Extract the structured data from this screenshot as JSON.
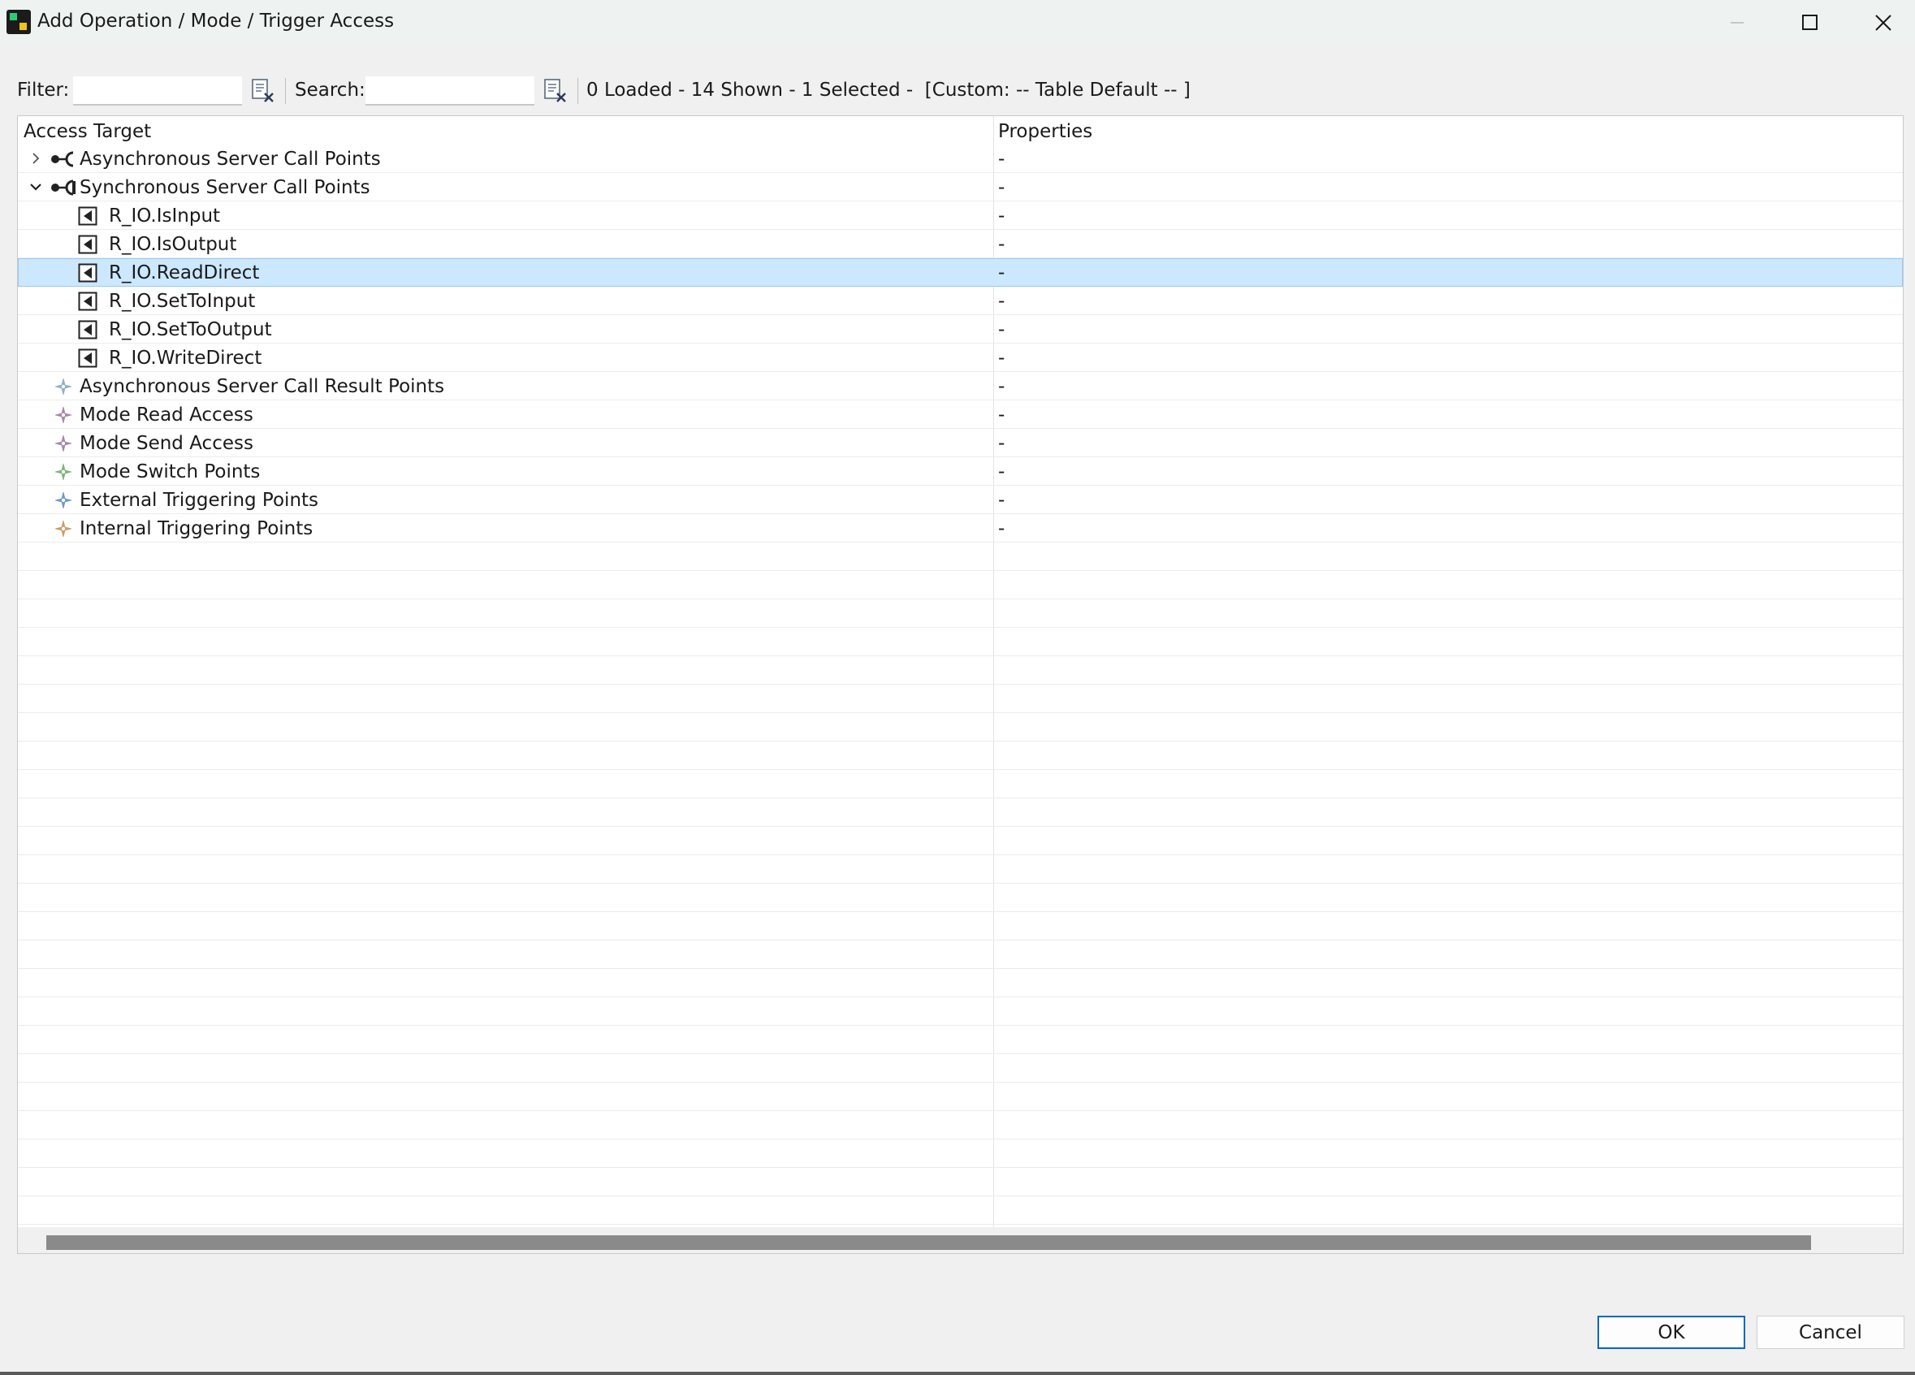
{
  "window": {
    "title": "Add Operation / Mode / Trigger Access"
  },
  "toolbar": {
    "filter_label": "Filter:",
    "filter_value": "",
    "search_label": "Search:",
    "search_value": "",
    "status": "0 Loaded - 14 Shown - 1 Selected -  [Custom: -- Table Default -- ]"
  },
  "table": {
    "columns": [
      "Access Target",
      "Properties"
    ],
    "rows": [
      {
        "label": "Asynchronous Server Call Points",
        "prop": "-",
        "level": 0,
        "toggle": "collapsed",
        "icon": "async-server-call-icon"
      },
      {
        "label": "Synchronous Server Call Points",
        "prop": "-",
        "level": 0,
        "toggle": "expanded",
        "icon": "sync-server-call-icon"
      },
      {
        "label": "R_IO.IsInput",
        "prop": "-",
        "level": 1,
        "icon": "operation-icon"
      },
      {
        "label": "R_IO.IsOutput",
        "prop": "-",
        "level": 1,
        "icon": "operation-icon"
      },
      {
        "label": "R_IO.ReadDirect",
        "prop": "-",
        "level": 1,
        "icon": "operation-icon",
        "selected": true
      },
      {
        "label": "R_IO.SetToInput",
        "prop": "-",
        "level": 1,
        "icon": "operation-icon"
      },
      {
        "label": "R_IO.SetToOutput",
        "prop": "-",
        "level": 1,
        "icon": "operation-icon"
      },
      {
        "label": "R_IO.WriteDirect",
        "prop": "-",
        "level": 1,
        "icon": "operation-icon"
      },
      {
        "label": "Asynchronous Server Call Result Points",
        "prop": "-",
        "level": 0,
        "icon": "result-point-icon",
        "color": "#7fa8c8"
      },
      {
        "label": "Mode Read Access",
        "prop": "-",
        "level": 0,
        "icon": "mode-read-icon",
        "color": "#a07aa0"
      },
      {
        "label": "Mode Send Access",
        "prop": "-",
        "level": 0,
        "icon": "mode-send-icon",
        "color": "#a07aa0"
      },
      {
        "label": "Mode Switch Points",
        "prop": "-",
        "level": 0,
        "icon": "mode-switch-icon",
        "color": "#6fae6f"
      },
      {
        "label": "External Triggering Points",
        "prop": "-",
        "level": 0,
        "icon": "external-trigger-icon",
        "color": "#5f8fc8"
      },
      {
        "label": "Internal Triggering Points",
        "prop": "-",
        "level": 0,
        "icon": "internal-trigger-icon",
        "color": "#c8905a"
      }
    ],
    "empty_rows": 24
  },
  "buttons": {
    "ok": "OK",
    "cancel": "Cancel"
  },
  "colors": {
    "selection": "#cce8ff",
    "ok_border": "#0067c0"
  }
}
